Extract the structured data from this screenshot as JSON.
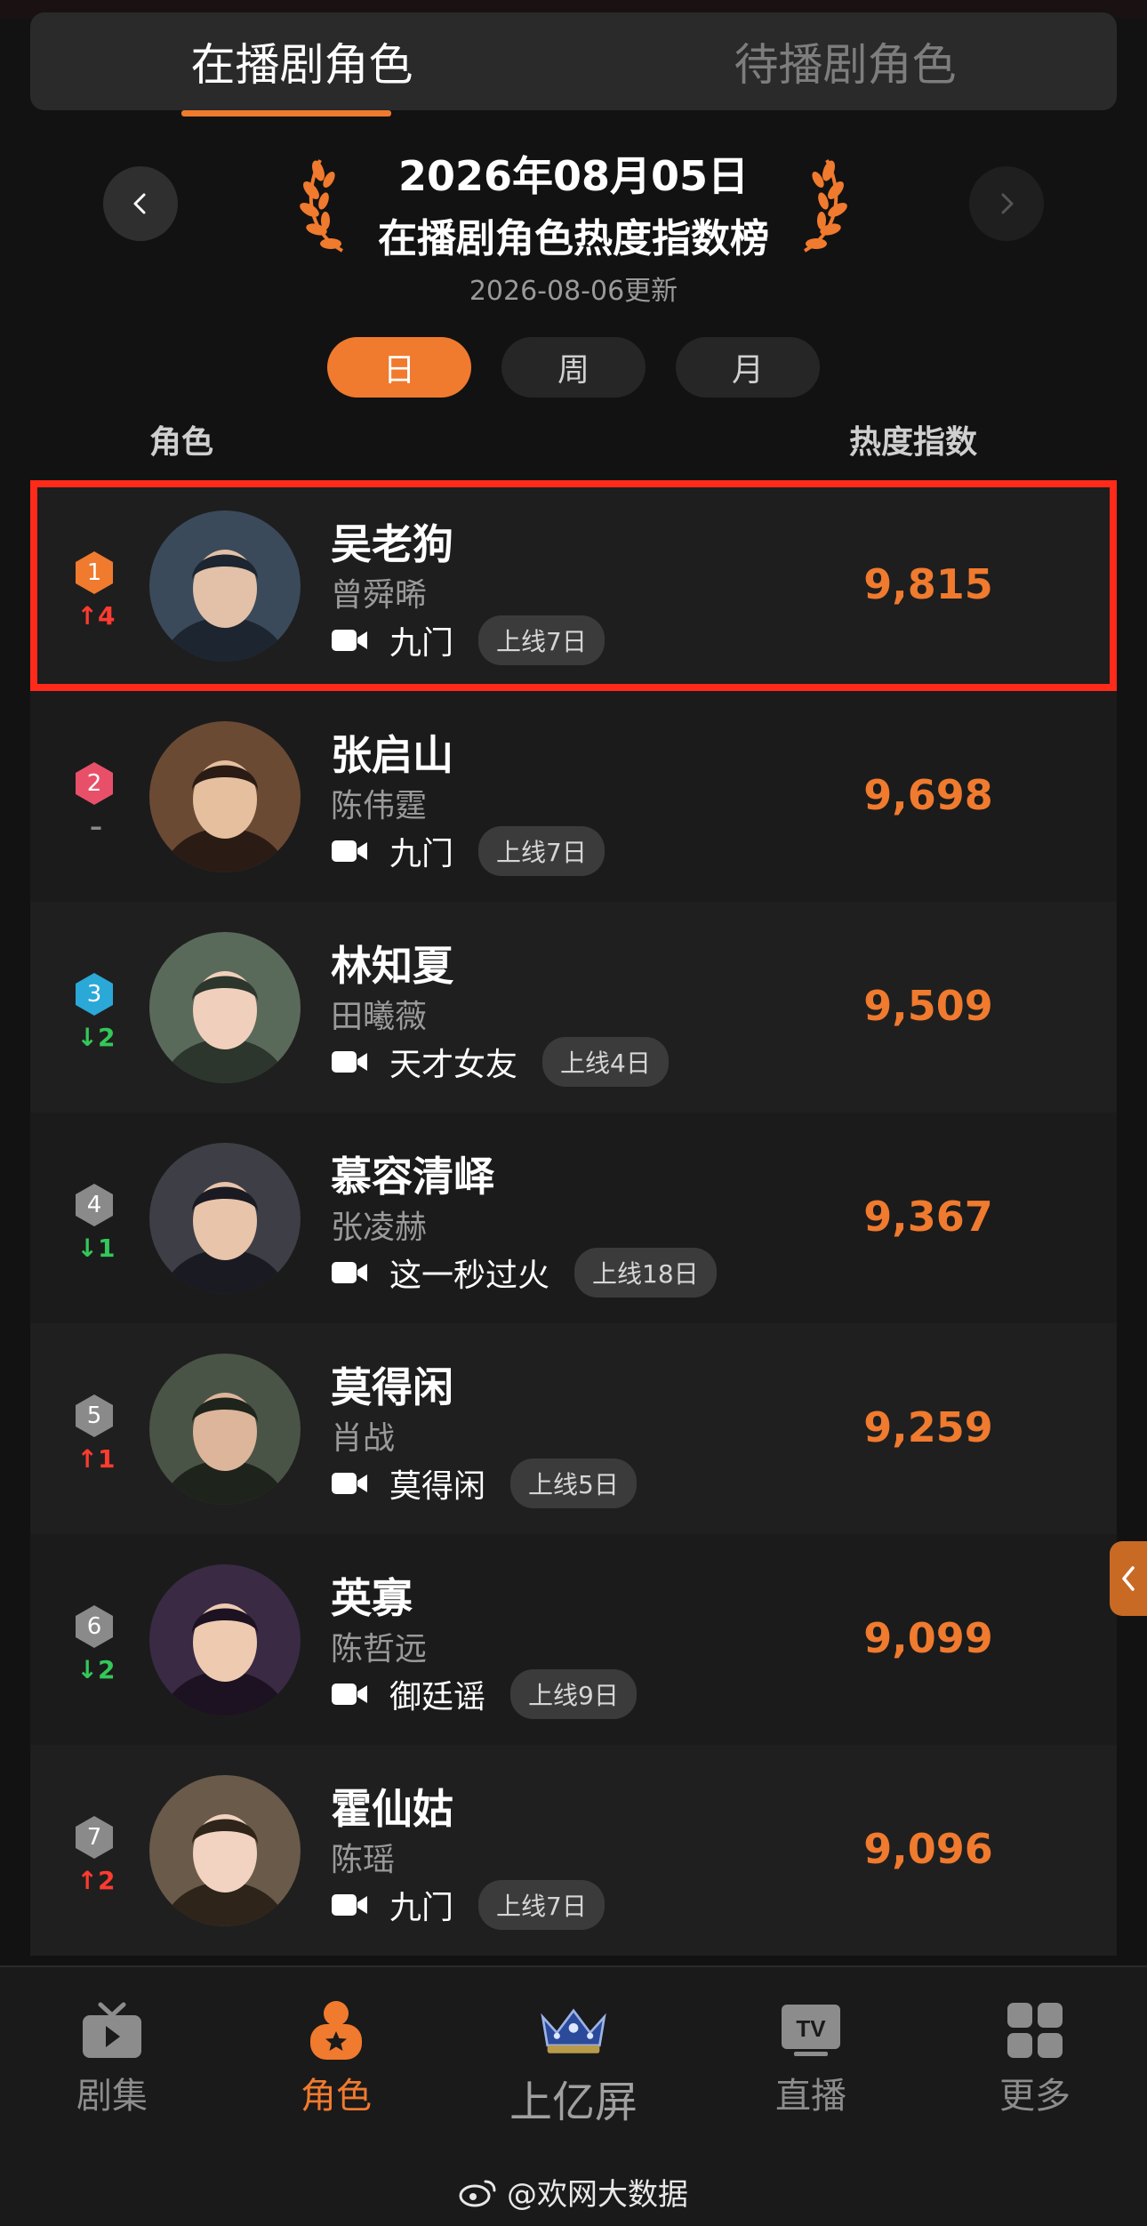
{
  "tabs": [
    {
      "label": "在播剧角色",
      "active": true
    },
    {
      "label": "待播剧角色",
      "active": false
    }
  ],
  "header": {
    "date": "2026年08月05日",
    "title": "在播剧角色热度指数榜",
    "updated": "2026-08-06更新"
  },
  "periods": [
    {
      "label": "日",
      "active": true
    },
    {
      "label": "周",
      "active": false
    },
    {
      "label": "月",
      "active": false
    }
  ],
  "columns": {
    "role": "角色",
    "heat": "热度指数"
  },
  "colors": {
    "accent": "#f07a2e",
    "highlight": "#ff2a1a",
    "up": "#ff3b30",
    "down": "#34c759"
  },
  "rows": [
    {
      "rank": "1",
      "change": "4",
      "direction": "up",
      "role": "吴老狗",
      "actor": "曾舜晞",
      "show": "九门",
      "online": "上线7日",
      "heat": "9,815",
      "badge_color": "#f07a2e"
    },
    {
      "rank": "2",
      "change": "–",
      "direction": "same",
      "role": "张启山",
      "actor": "陈伟霆",
      "show": "九门",
      "online": "上线7日",
      "heat": "9,698",
      "badge_color": "#e8506a"
    },
    {
      "rank": "3",
      "change": "2",
      "direction": "down",
      "role": "林知夏",
      "actor": "田曦薇",
      "show": "天才女友",
      "online": "上线4日",
      "heat": "9,509",
      "badge_color": "#2aa8d8"
    },
    {
      "rank": "4",
      "change": "1",
      "direction": "down",
      "role": "慕容清峄",
      "actor": "张凌赫",
      "show": "这一秒过火",
      "online": "上线18日",
      "heat": "9,367",
      "badge_color": "#8a8a8a"
    },
    {
      "rank": "5",
      "change": "1",
      "direction": "up",
      "role": "莫得闲",
      "actor": "肖战",
      "show": "莫得闲",
      "online": "上线5日",
      "heat": "9,259",
      "badge_color": "#8a8a8a"
    },
    {
      "rank": "6",
      "change": "2",
      "direction": "down",
      "role": "英寡",
      "actor": "陈哲远",
      "show": "御廷谣",
      "online": "上线9日",
      "heat": "9,099",
      "badge_color": "#8a8a8a"
    },
    {
      "rank": "7",
      "change": "2",
      "direction": "up",
      "role": "霍仙姑",
      "actor": "陈瑶",
      "show": "九门",
      "online": "上线7日",
      "heat": "9,096",
      "badge_color": "#8a8a8a"
    }
  ],
  "bottom_nav": [
    {
      "label": "剧集",
      "icon": "tv-icon",
      "active": false
    },
    {
      "label": "角色",
      "icon": "person-star-icon",
      "active": true
    },
    {
      "label": "上亿屏",
      "icon": "crown-icon",
      "active": false
    },
    {
      "label": "直播",
      "icon": "tv-live-icon",
      "active": false
    },
    {
      "label": "更多",
      "icon": "grid-icon",
      "active": false
    }
  ],
  "watermark": "@欢网大数据"
}
